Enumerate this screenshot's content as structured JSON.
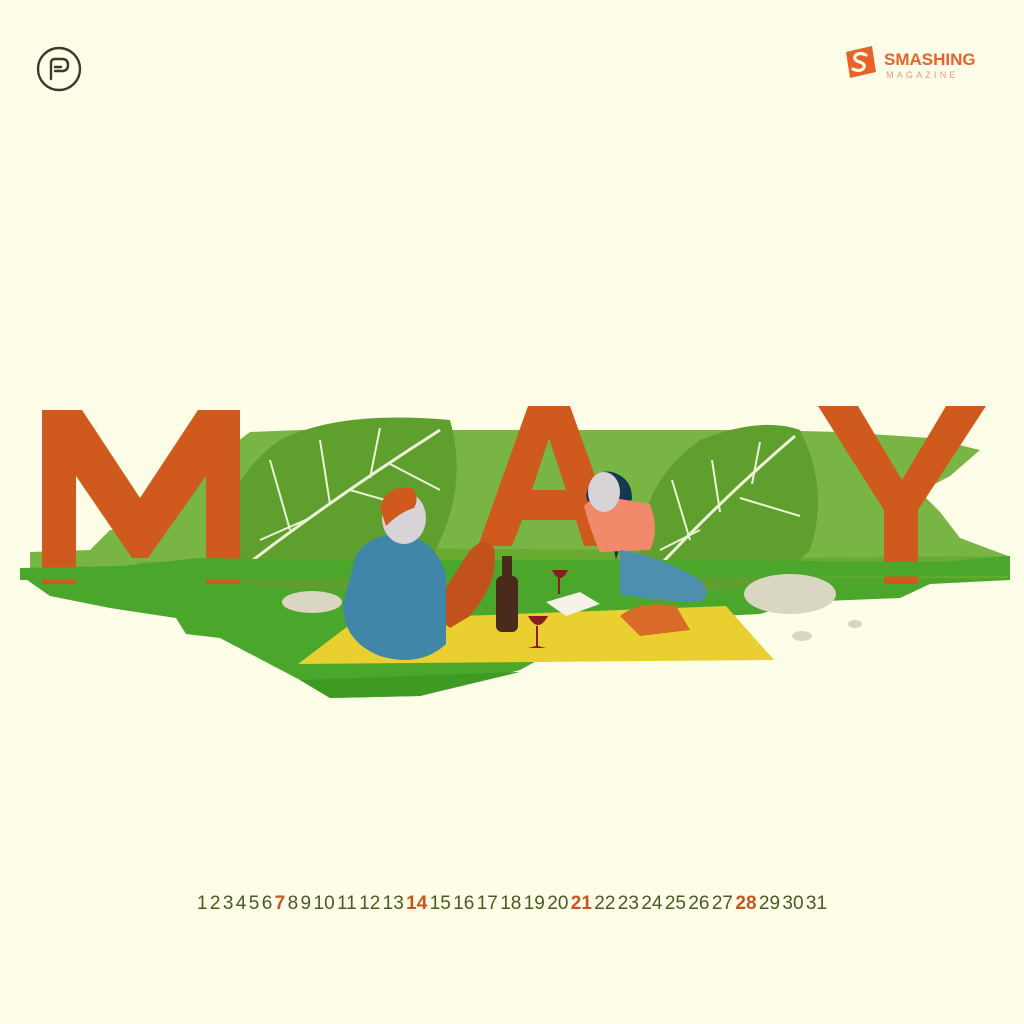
{
  "branding": {
    "left_logo_icon": "p-circle-logo-icon",
    "right_logo_icon": "smashing-s-icon",
    "right_logo_name": "SMASHING",
    "right_logo_sub": "MAGAZINE"
  },
  "illustration": {
    "month_title": "MAY",
    "scene": "picnic-scene"
  },
  "colors": {
    "background": "#fdfde8",
    "accent_orange": "#d05a1e",
    "grass_green": "#5aa52a",
    "day_text": "#4a5a22",
    "highlight_day": "#c8551f"
  },
  "calendar": {
    "days": [
      {
        "label": "1",
        "highlight": false
      },
      {
        "label": "2",
        "highlight": false
      },
      {
        "label": "3",
        "highlight": false
      },
      {
        "label": "4",
        "highlight": false
      },
      {
        "label": "5",
        "highlight": false
      },
      {
        "label": "6",
        "highlight": false
      },
      {
        "label": "7",
        "highlight": true
      },
      {
        "label": "8",
        "highlight": false
      },
      {
        "label": "9",
        "highlight": false
      },
      {
        "label": "10",
        "highlight": false
      },
      {
        "label": "11",
        "highlight": false
      },
      {
        "label": "12",
        "highlight": false
      },
      {
        "label": "13",
        "highlight": false
      },
      {
        "label": "14",
        "highlight": true
      },
      {
        "label": "15",
        "highlight": false
      },
      {
        "label": "16",
        "highlight": false
      },
      {
        "label": "17",
        "highlight": false
      },
      {
        "label": "18",
        "highlight": false
      },
      {
        "label": "19",
        "highlight": false
      },
      {
        "label": "20",
        "highlight": false
      },
      {
        "label": "21",
        "highlight": true
      },
      {
        "label": "22",
        "highlight": false
      },
      {
        "label": "23",
        "highlight": false
      },
      {
        "label": "24",
        "highlight": false
      },
      {
        "label": "25",
        "highlight": false
      },
      {
        "label": "26",
        "highlight": false
      },
      {
        "label": "27",
        "highlight": false
      },
      {
        "label": "28",
        "highlight": true
      },
      {
        "label": "29",
        "highlight": false
      },
      {
        "label": "30",
        "highlight": false
      },
      {
        "label": "31",
        "highlight": false
      }
    ]
  }
}
